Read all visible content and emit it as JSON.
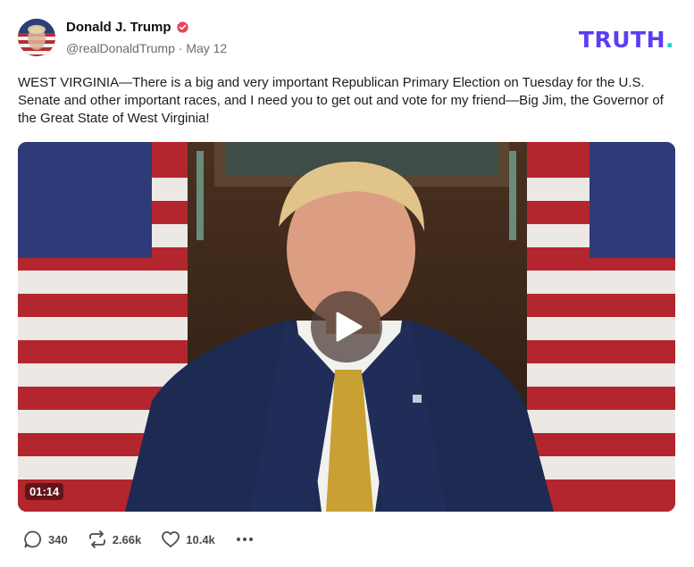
{
  "author": {
    "name": "Donald J. Trump",
    "handle": "@realDonaldTrump",
    "separator": "·",
    "date": "May 12"
  },
  "brand": {
    "logo_text": "TRUTH",
    "logo_dot": "."
  },
  "post": {
    "text": "WEST VIRGINIA—There is a big and very important Republican Primary Election on Tuesday for the U.S. Senate and other important races, and I need you to get out and vote for my friend—Big Jim, the Governor of the Great State of West Virginia!"
  },
  "media": {
    "duration": "01:14",
    "icon": "play-icon"
  },
  "actions": {
    "replies": "340",
    "retruths": "2.66k",
    "likes": "10.4k"
  },
  "colors": {
    "brand_purple": "#5b3df5",
    "brand_teal": "#17d1c6",
    "verified": "#e8455b"
  }
}
